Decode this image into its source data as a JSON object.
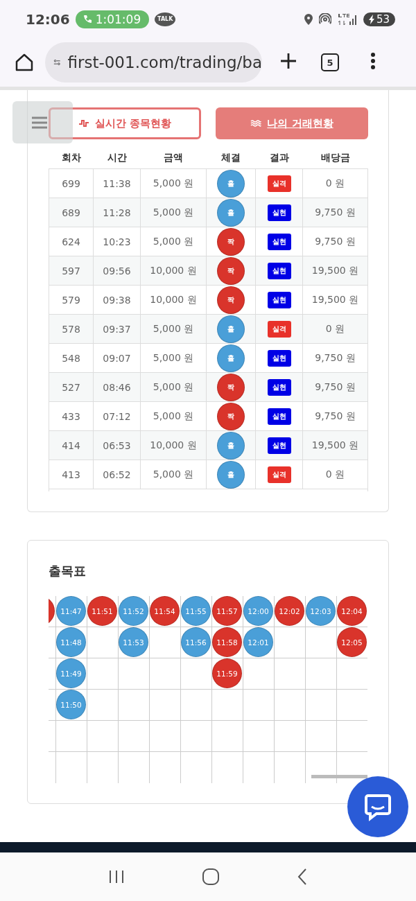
{
  "status_bar": {
    "time": "12:06",
    "call_timer": "1:01:09",
    "talk_badge": "TALK",
    "battery": "53"
  },
  "browser": {
    "url": "first-001.com/trading/ba",
    "tab_count": "5"
  },
  "header_buttons": [
    {
      "label": "실시간 종목현황",
      "selected": false
    },
    {
      "label": "나의 거래현황",
      "selected": true
    }
  ],
  "table": {
    "columns": [
      "회차",
      "시간",
      "금액",
      "체결",
      "결과",
      "배당금"
    ],
    "rows": [
      {
        "round": "699",
        "time": "11:38",
        "amount": "5,000 원",
        "pick": {
          "label": "홀",
          "color": "#4a9fd8"
        },
        "result": {
          "label": "실격",
          "color": "#e8312a"
        },
        "payout": "0 원"
      },
      {
        "round": "689",
        "time": "11:28",
        "amount": "5,000 원",
        "pick": {
          "label": "홀",
          "color": "#4a9fd8"
        },
        "result": {
          "label": "실현",
          "color": "#0000e6"
        },
        "payout": "9,750 원"
      },
      {
        "round": "624",
        "time": "10:23",
        "amount": "5,000 원",
        "pick": {
          "label": "짝",
          "color": "#d9342b"
        },
        "result": {
          "label": "실현",
          "color": "#0000e6"
        },
        "payout": "9,750 원"
      },
      {
        "round": "597",
        "time": "09:56",
        "amount": "10,000 원",
        "pick": {
          "label": "짝",
          "color": "#d9342b"
        },
        "result": {
          "label": "실현",
          "color": "#0000e6"
        },
        "payout": "19,500 원"
      },
      {
        "round": "579",
        "time": "09:38",
        "amount": "10,000 원",
        "pick": {
          "label": "짝",
          "color": "#d9342b"
        },
        "result": {
          "label": "실현",
          "color": "#0000e6"
        },
        "payout": "19,500 원"
      },
      {
        "round": "578",
        "time": "09:37",
        "amount": "5,000 원",
        "pick": {
          "label": "홀",
          "color": "#4a9fd8"
        },
        "result": {
          "label": "실격",
          "color": "#e8312a"
        },
        "payout": "0 원"
      },
      {
        "round": "548",
        "time": "09:07",
        "amount": "5,000 원",
        "pick": {
          "label": "홀",
          "color": "#4a9fd8"
        },
        "result": {
          "label": "실현",
          "color": "#0000e6"
        },
        "payout": "9,750 원"
      },
      {
        "round": "527",
        "time": "08:46",
        "amount": "5,000 원",
        "pick": {
          "label": "짝",
          "color": "#d9342b"
        },
        "result": {
          "label": "실현",
          "color": "#0000e6"
        },
        "payout": "9,750 원"
      },
      {
        "round": "433",
        "time": "07:12",
        "amount": "5,000 원",
        "pick": {
          "label": "짝",
          "color": "#d9342b"
        },
        "result": {
          "label": "실현",
          "color": "#0000e6"
        },
        "payout": "9,750 원"
      },
      {
        "round": "414",
        "time": "06:53",
        "amount": "10,000 원",
        "pick": {
          "label": "홀",
          "color": "#4a9fd8"
        },
        "result": {
          "label": "실현",
          "color": "#0000e6"
        },
        "payout": "19,500 원"
      },
      {
        "round": "413",
        "time": "06:52",
        "amount": "5,000 원",
        "pick": {
          "label": "홀",
          "color": "#4a9fd8"
        },
        "result": {
          "label": "실격",
          "color": "#e8312a"
        },
        "payout": "0 원"
      }
    ]
  },
  "bead_board": {
    "title": "출목표",
    "columns": [
      {
        "beads": [
          {
            "color": "#d9342b"
          }
        ]
      },
      {
        "beads": [
          {
            "time": "11:47",
            "color": "#4a9fd8"
          },
          {
            "time": "11:48",
            "color": "#4a9fd8"
          },
          {
            "time": "11:49",
            "color": "#4a9fd8"
          },
          {
            "time": "11:50",
            "color": "#4a9fd8"
          }
        ]
      },
      {
        "beads": [
          {
            "time": "11:51",
            "color": "#d9342b"
          }
        ]
      },
      {
        "beads": [
          {
            "time": "11:52",
            "color": "#4a9fd8"
          },
          {
            "time": "11:53",
            "color": "#4a9fd8"
          }
        ]
      },
      {
        "beads": [
          {
            "time": "11:54",
            "color": "#d9342b"
          }
        ]
      },
      {
        "beads": [
          {
            "time": "11:55",
            "color": "#4a9fd8"
          },
          {
            "time": "11:56",
            "color": "#4a9fd8"
          }
        ]
      },
      {
        "beads": [
          {
            "time": "11:57",
            "color": "#d9342b"
          },
          {
            "time": "11:58",
            "color": "#d9342b"
          },
          {
            "time": "11:59",
            "color": "#d9342b"
          }
        ]
      },
      {
        "beads": [
          {
            "time": "12:00",
            "color": "#4a9fd8"
          },
          {
            "time": "12:01",
            "color": "#4a9fd8"
          }
        ]
      },
      {
        "beads": [
          {
            "time": "12:02",
            "color": "#d9342b"
          }
        ]
      },
      {
        "beads": [
          {
            "time": "12:03",
            "color": "#4a9fd8"
          }
        ]
      },
      {
        "beads": [
          {
            "time": "12:04",
            "color": "#d9342b"
          },
          {
            "time": "12:05",
            "color": "#d9342b"
          }
        ]
      }
    ]
  }
}
